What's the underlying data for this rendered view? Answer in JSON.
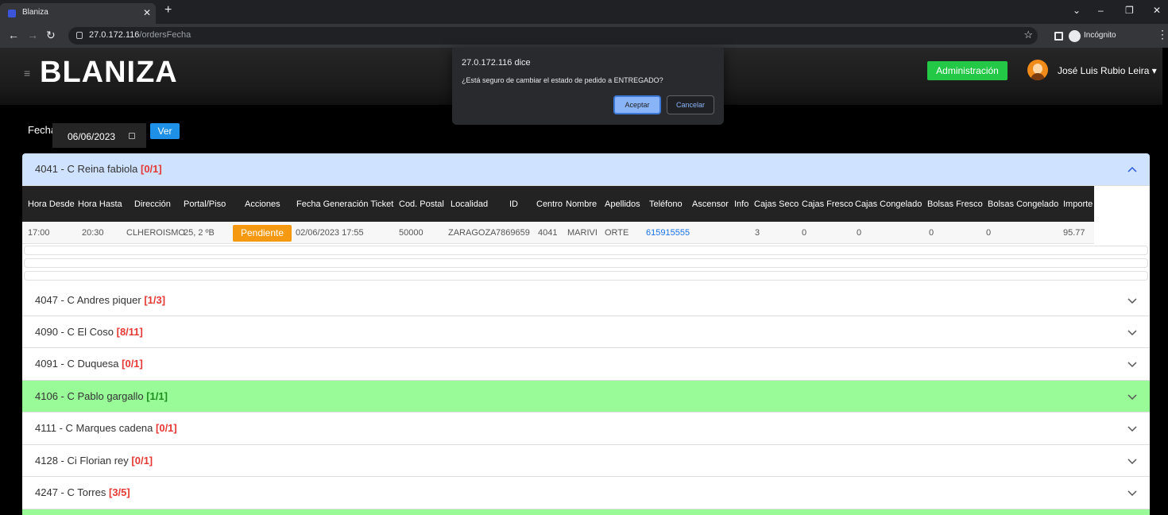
{
  "browser": {
    "tab_title": "Blaniza",
    "url_host": "27.0.172.116",
    "url_path": "/ordersFecha",
    "incognito_label": "Incógnito"
  },
  "header": {
    "brand": "BLANIZA",
    "admin_label": "Administración",
    "user_name": "José Luis Rubio Leira",
    "admin_color": "#23c846"
  },
  "filter": {
    "label": "Fecha",
    "date": "06/06/2023",
    "button": "Ver"
  },
  "orders_table": {
    "headers": [
      "Hora Desde",
      "Hora Hasta",
      "Dirección",
      "Portal/Piso",
      "Acciones",
      "Fecha Generación Ticket",
      "Cod. Postal",
      "Localidad",
      "ID",
      "Centro",
      "Nombre",
      "Apellidos",
      "Teléfono",
      "Ascensor",
      "Info",
      "Cajas Seco",
      "Cajas Fresco",
      "Cajas Congelado",
      "Bolsas Fresco",
      "Bolsas Congelado",
      "Importe"
    ],
    "row": {
      "hora_desde": "17:00",
      "hora_hasta": "20:30",
      "direccion": "CLHEROISMO",
      "portal": "25, 2 ºB",
      "accion": "Pendiente",
      "fecha_ticket": "02/06/2023 17:55",
      "cod_postal": "50000",
      "localidad": "ZARAGOZA",
      "id": "7869659",
      "centro": "4041",
      "nombre": "MARIVI",
      "apellidos": "ORTE",
      "telefono": "615915555",
      "cajas_seco": "3",
      "cajas_fresco": "0",
      "cajas_congelado": "0",
      "bolsas_fresco": "0",
      "bolsas_congelado": "0",
      "importe": "95.77"
    }
  },
  "groups": [
    {
      "name": "4041 - C Reina fabiola",
      "count": "[0/1]",
      "state": "expanded"
    },
    {
      "name": "4047 - C Andres piquer",
      "count": "[1/3]",
      "state": "collapsed"
    },
    {
      "name": "4090 - C El Coso",
      "count": "[8/11]",
      "state": "collapsed"
    },
    {
      "name": "4091 - C Duquesa",
      "count": "[0/1]",
      "state": "collapsed"
    },
    {
      "name": "4106 - C Pablo gargallo",
      "count": "[1/1]",
      "state": "complete"
    },
    {
      "name": "4111 - C Marques cadena",
      "count": "[0/1]",
      "state": "collapsed"
    },
    {
      "name": "4128 - Ci Florian rey",
      "count": "[0/1]",
      "state": "collapsed"
    },
    {
      "name": "4247 - C Torres",
      "count": "[3/5]",
      "state": "collapsed"
    }
  ],
  "dialog": {
    "title": "27.0.172.116 dice",
    "message": "¿Está seguro de cambiar el estado de pedido a ENTREGADO?",
    "ok": "Aceptar",
    "cancel": "Cancelar"
  },
  "colors": {
    "expanded_header": "#cfe2ff",
    "complete_row": "#98fb98",
    "pending_button": "#f59a10"
  }
}
